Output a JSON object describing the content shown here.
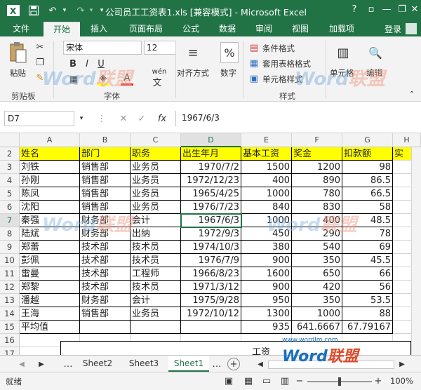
{
  "window": {
    "title": "公司员工工资表1.xls [兼容模式] - Microsoft Excel",
    "help": "?",
    "minimize": "—",
    "restore": "❐",
    "close": "✕"
  },
  "ribbon_tabs": [
    {
      "label": "文件"
    },
    {
      "label": "开始"
    },
    {
      "label": "插入"
    },
    {
      "label": "页面布局"
    },
    {
      "label": "公式"
    },
    {
      "label": "数据"
    },
    {
      "label": "审阅"
    },
    {
      "label": "视图"
    },
    {
      "label": "加载项"
    }
  ],
  "login": "登录",
  "ribbon": {
    "paste": "粘贴",
    "clipboard": "剪贴板",
    "font_name": "宋体",
    "font_size": "12",
    "font_group": "字体",
    "align": "对齐方式",
    "number": "数字",
    "percent": "%",
    "cond_format": "条件格式",
    "table_format": "套用表格格式",
    "cell_style": "单元格样式",
    "styles": "样式",
    "cells": "单元格",
    "edit": "编辑",
    "wen": "wén",
    "wen_char": "文"
  },
  "formula_bar": {
    "name": "D7",
    "fx": "fx",
    "value": "1967/6/3"
  },
  "columns": [
    "A",
    "B",
    "C",
    "D",
    "E",
    "F",
    "G",
    "H"
  ],
  "rows": [
    {
      "n": "2",
      "cells": [
        "姓名",
        "部门",
        "职务",
        "出生年月",
        "基本工资",
        "奖金",
        "扣款额",
        "实"
      ]
    },
    {
      "n": "3",
      "cells": [
        "刘铁",
        "销售部",
        "业务员",
        "1970/7/2",
        "1500",
        "1200",
        "98",
        ""
      ]
    },
    {
      "n": "4",
      "cells": [
        "孙刚",
        "销售部",
        "业务员",
        "1972/12/23",
        "400",
        "890",
        "86.5",
        ""
      ]
    },
    {
      "n": "5",
      "cells": [
        "陈凤",
        "销售部",
        "业务员",
        "1965/4/25",
        "1000",
        "780",
        "66.5",
        ""
      ]
    },
    {
      "n": "6",
      "cells": [
        "沈阳",
        "销售部",
        "业务员",
        "1976/7/23",
        "840",
        "830",
        "58",
        ""
      ]
    },
    {
      "n": "7",
      "cells": [
        "秦强",
        "财务部",
        "会计",
        "1967/6/3",
        "1000",
        "400",
        "48.5",
        ""
      ]
    },
    {
      "n": "8",
      "cells": [
        "陆斌",
        "财务部",
        "出纳",
        "1972/9/3",
        "450",
        "290",
        "78",
        ""
      ]
    },
    {
      "n": "9",
      "cells": [
        "郑蕾",
        "技术部",
        "技术员",
        "1974/10/3",
        "380",
        "540",
        "69",
        ""
      ]
    },
    {
      "n": "10",
      "cells": [
        "彭佩",
        "技术部",
        "技术员",
        "1976/7/9",
        "900",
        "350",
        "45.5",
        ""
      ]
    },
    {
      "n": "11",
      "cells": [
        "雷曼",
        "技术部",
        "工程师",
        "1966/8/23",
        "1600",
        "650",
        "66",
        ""
      ]
    },
    {
      "n": "12",
      "cells": [
        "郑黎",
        "技术部",
        "技术员",
        "1971/3/12",
        "900",
        "420",
        "56",
        ""
      ]
    },
    {
      "n": "13",
      "cells": [
        "潘越",
        "财务部",
        "会计",
        "1975/9/28",
        "950",
        "350",
        "53.5",
        ""
      ]
    },
    {
      "n": "14",
      "cells": [
        "王海",
        "销售部",
        "业务员",
        "1972/10/12",
        "1300",
        "1000",
        "88",
        ""
      ]
    },
    {
      "n": "15",
      "cells": [
        "平均值",
        "",
        "",
        "",
        "935",
        "641.6667",
        "67.79167",
        ""
      ]
    },
    {
      "n": "16",
      "cells": [
        "",
        "",
        "",
        "",
        "",
        "",
        "",
        ""
      ]
    },
    {
      "n": "17",
      "cells": [
        "",
        "",
        "",
        "",
        "",
        "",
        "",
        ""
      ]
    }
  ],
  "partial_text_row17": "工资",
  "sheet_tabs": [
    {
      "label": "Sheet2"
    },
    {
      "label": "Sheet3"
    },
    {
      "label": "Sheet1"
    }
  ],
  "status": {
    "ready": "就绪",
    "zoom": "100%",
    "minus": "−",
    "plus": "+"
  },
  "watermarks": {
    "word": "Word",
    "lianmeng": "联盟",
    "url": "www.wordlm.com"
  },
  "colors": {
    "excel_green": "#217346",
    "highlight": "#ffff00"
  }
}
